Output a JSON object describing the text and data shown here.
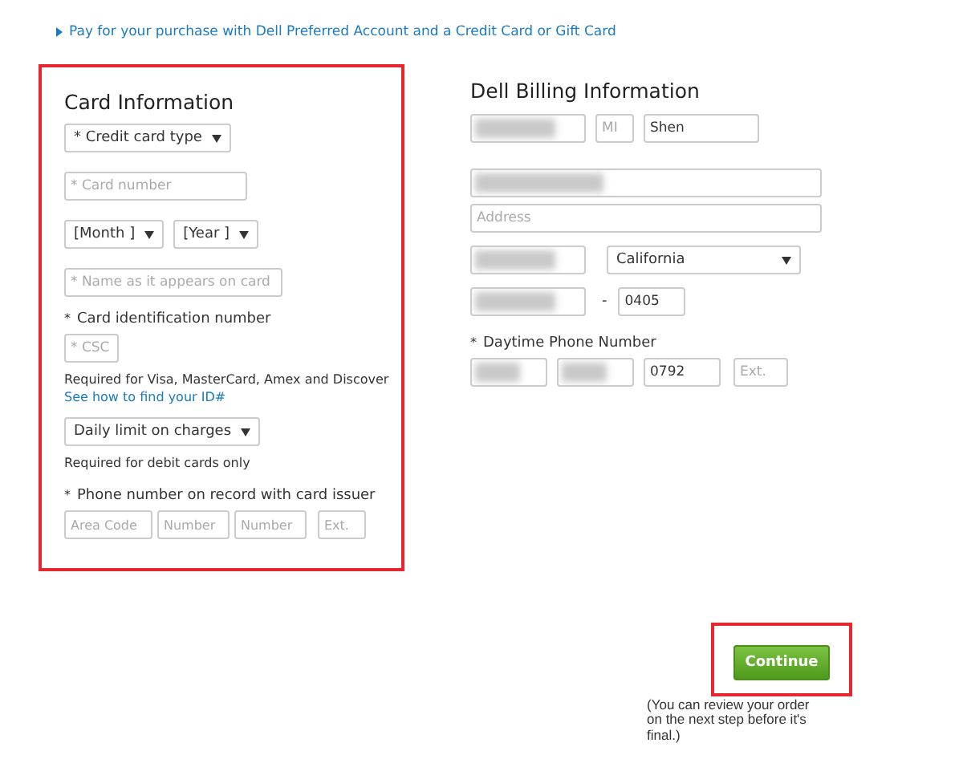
{
  "top_link": {
    "text": "Pay for your purchase with Dell Preferred Account and a Credit Card or Gift Card"
  },
  "card_info": {
    "title": "Card Information",
    "card_type": {
      "value": "* Credit card type"
    },
    "card_number": {
      "placeholder": "* Card number"
    },
    "month": {
      "value": "[Month ]"
    },
    "year": {
      "value": "[Year ]"
    },
    "name": {
      "placeholder": "* Name as it appears on card"
    },
    "id_marker": "*",
    "id_label": "Card identification number",
    "csc": {
      "placeholder": "* CSC"
    },
    "id_note": "Required for Visa, MasterCard, Amex and Discover",
    "id_link": "See how to find your ID#",
    "daily_limit": {
      "value": "Daily limit on charges"
    },
    "debit_note": "Required for debit cards only",
    "phone_marker": "*",
    "phone_label": "Phone number on record with card issuer",
    "phone_fields": [
      {
        "placeholder": "Area Code"
      },
      {
        "placeholder": "Number"
      },
      {
        "placeholder": "Number"
      },
      {
        "placeholder": "Ext."
      }
    ]
  },
  "billing": {
    "title": "Dell Billing Information",
    "name_row": [
      {
        "blurred": true
      },
      {
        "placeholder": "MI"
      },
      {
        "value": "Shen"
      }
    ],
    "address1": {
      "blurred": true
    },
    "address2": {
      "placeholder": "Address"
    },
    "city": {
      "blurred": true
    },
    "state": {
      "value": "California"
    },
    "zip": {
      "blurred": true
    },
    "zip_separator": "-",
    "zip_ext": {
      "value": "0405"
    },
    "phone_marker": "*",
    "phone_label": "Daytime Phone Number",
    "phone_fields": [
      {
        "blurred": true
      },
      {
        "blurred": true
      },
      {
        "value": "0792"
      },
      {
        "placeholder": "Ext."
      }
    ]
  },
  "continue_button": {
    "label": "Continue"
  },
  "review_note": "(You can review your order on the next step before it's final.)"
}
